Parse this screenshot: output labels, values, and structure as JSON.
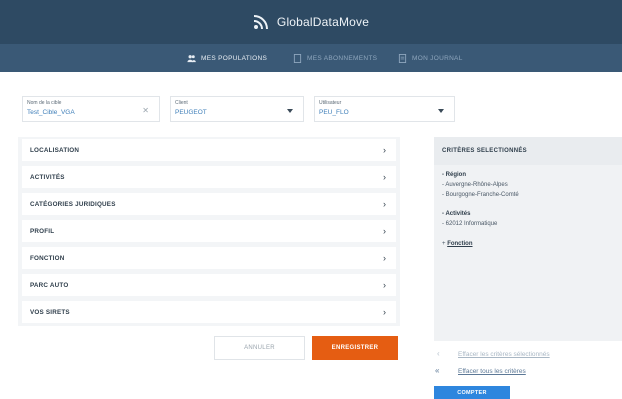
{
  "header": {
    "brand": "GlobalDataMove"
  },
  "nav": [
    {
      "label": "MES POPULATIONS",
      "icon": "users-icon",
      "active": true
    },
    {
      "label": "MES ABONNEMENTS",
      "icon": "document-icon",
      "active": false
    },
    {
      "label": "MON JOURNAL",
      "icon": "journal-icon",
      "active": false
    }
  ],
  "filters": [
    {
      "label": "Nom de la cible",
      "value": "Test_Cible_VGA",
      "control": "clear"
    },
    {
      "label": "Client",
      "value": "PEUGEOT",
      "control": "dropdown"
    },
    {
      "label": "Utilisateur",
      "value": "PEU_FLO",
      "control": "dropdown"
    }
  ],
  "accordion": [
    "LOCALISATION",
    "ACTIVITÉS",
    "CATÉGORIES JURIDIQUES",
    "PROFIL",
    "FONCTION",
    "PARC AUTO",
    "VOS SIRETS"
  ],
  "actions": {
    "cancel": "ANNULER",
    "save": "ENREGISTRER"
  },
  "criteria": {
    "title": "CRITÈRES SELECTIONNÉS",
    "region_label": "- Région",
    "regions": [
      "- Auvergne-Rhône-Alpes",
      "- Bourgogne-Franche-Comté"
    ],
    "activities_label": "- Activités",
    "activities": [
      "- 62012 Informatique"
    ],
    "function_prefix": "+",
    "function_link": "Fonction"
  },
  "side_links": {
    "clear_selected": "Effacer les critères sélectionnés",
    "clear_all": "Effacer tous les critères"
  },
  "count_button": "COMPTER",
  "colors": {
    "header": "#2e4a63",
    "nav": "#3a5976",
    "accent_orange": "#e55d12",
    "accent_blue": "#2e86de"
  }
}
